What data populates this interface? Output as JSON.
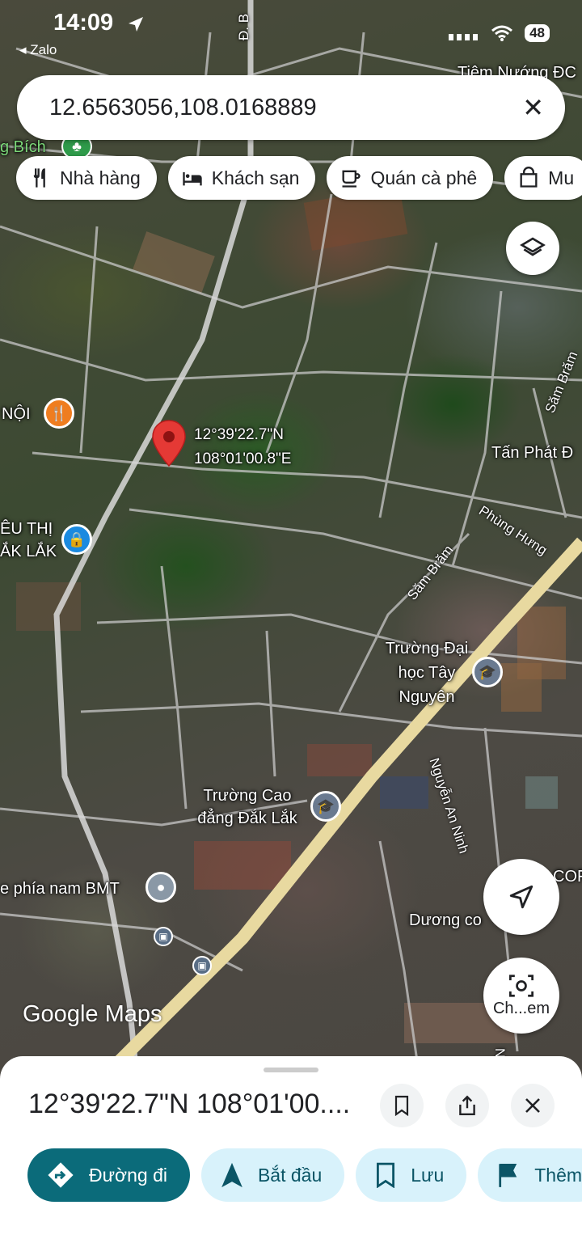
{
  "status_bar": {
    "time": "14:09",
    "back_app": "◂ Zalo",
    "battery": "48"
  },
  "search": {
    "query": "12.6563056,108.0168889",
    "clear_icon": "close-icon"
  },
  "chips": [
    {
      "label": "Nhà hàng",
      "icon": "restaurant-icon"
    },
    {
      "label": "Khách sạn",
      "icon": "hotel-icon"
    },
    {
      "label": "Quán cà phê",
      "icon": "coffee-icon"
    },
    {
      "label": "Mu",
      "icon": "shopping-bag-icon"
    }
  ],
  "map": {
    "pin_label_lat": "12°39'22.7\"N",
    "pin_label_lng": "108°01'00.8\"E",
    "labels": {
      "tiem_nuong": "Tiệm Nướng ĐC",
      "bich": "g Bích",
      "noi": "NỘI",
      "sieu_thi_1": "ÊU THỊ",
      "sieu_thi_2": "ẮK LẮK",
      "tan_phat": "Tấn Phát Đ",
      "truong_dai_hoc_1": "Trường Đại",
      "truong_dai_hoc_2": "học Tây",
      "truong_dai_hoc_3": "Nguyên",
      "truong_cao_dang_1": "Trường Cao",
      "truong_cao_dang_2": "đẳng Đắk Lắk",
      "phia_nam": "e phía nam BMT",
      "duong_co": "Dương co",
      "cof": "COF",
      "google_maps": "Google Maps"
    },
    "streets": {
      "sam_bram_1": "Săm Brăm",
      "sam_bram_2": "Săm Brăm",
      "phung_hung": "Phùng Hưng",
      "nguyen_an_ninh": "Nguyễn An Ninh",
      "d_b": "Đ. B",
      "ng": "Ng"
    }
  },
  "buttons": {
    "lens_label": "Ch...em"
  },
  "sheet": {
    "title": "12°39'22.7\"N 108°01'00....",
    "actions": [
      {
        "label": "Đường đi",
        "icon": "directions-icon"
      },
      {
        "label": "Bắt đầu",
        "icon": "navigation-arrow-icon"
      },
      {
        "label": "Lưu",
        "icon": "bookmark-icon"
      },
      {
        "label": "Thêm",
        "icon": "flag-icon"
      }
    ]
  },
  "colors": {
    "pin": "#e53935",
    "primary_action": "#0b6b7a",
    "action_bg": "#d8f2fb",
    "highway": "#e8d9a0"
  }
}
